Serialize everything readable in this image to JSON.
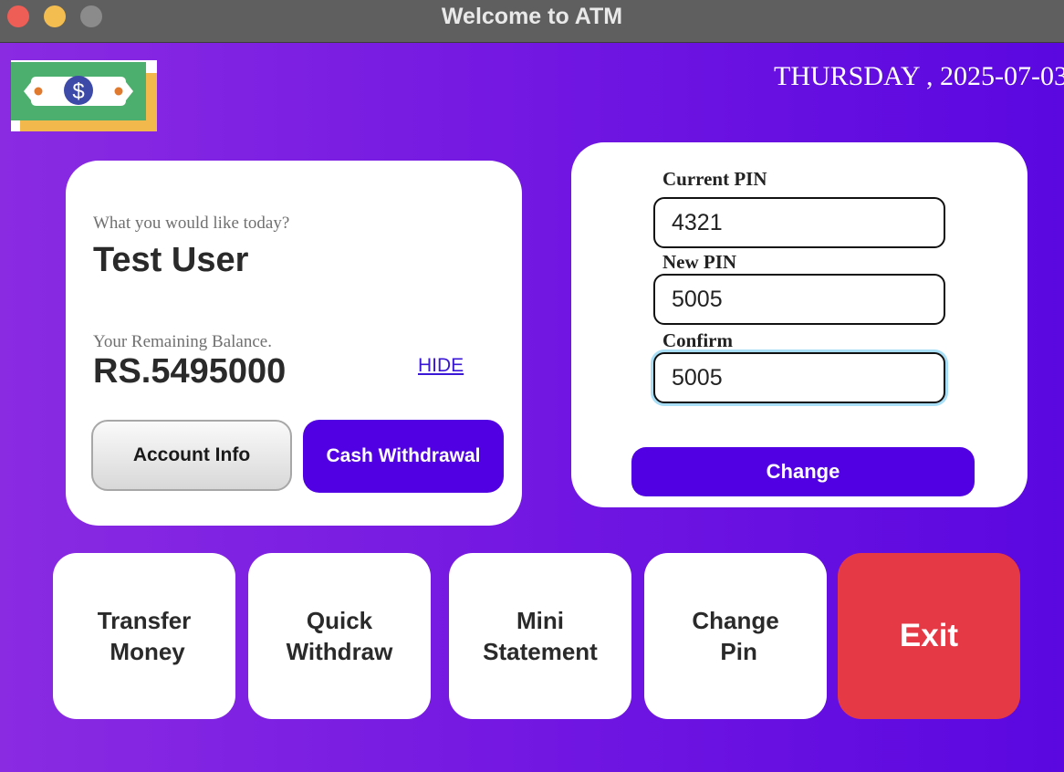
{
  "window": {
    "title": "Welcome to ATM"
  },
  "header": {
    "date": "THURSDAY , 2025-07-03",
    "logo_icon": "money-bill-icon"
  },
  "account_card": {
    "greeting": "What you would like today?",
    "user_name": "Test User",
    "balance_label": "Your Remaining Balance.",
    "balance": "RS.5495000",
    "hide_link": "HIDE",
    "account_info_button": "Account Info",
    "cash_withdrawal_button": "Cash Withdrawal"
  },
  "pin_card": {
    "current_pin_label": "Current PIN",
    "current_pin_value": "4321",
    "new_pin_label": "New PIN",
    "new_pin_value": "5005",
    "confirm_label": "Confirm",
    "confirm_value": "5005",
    "change_button": "Change"
  },
  "actions": [
    {
      "label": "Transfer\n Money"
    },
    {
      "label": "Quick\nWithdraw"
    },
    {
      "label": "Mini\nStatement"
    },
    {
      "label": "Change\n Pin"
    },
    {
      "label": "Exit"
    }
  ],
  "colors": {
    "accent": "#5000e2",
    "exit": "#e63946",
    "background_start": "#8a2be2",
    "background_end": "#5a07e0"
  }
}
